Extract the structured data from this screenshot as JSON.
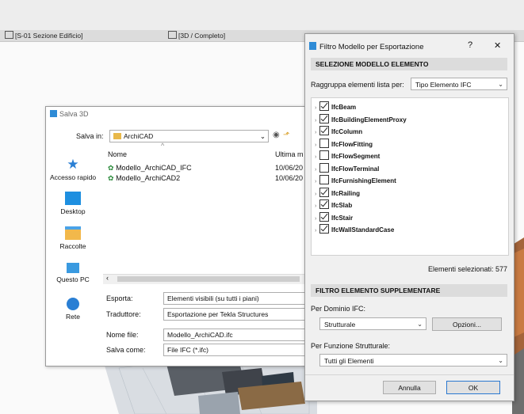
{
  "tabs": [
    {
      "label": "[S-01 Sezione Edificio]"
    },
    {
      "label": "[3D / Completo]"
    }
  ],
  "salva": {
    "title": "Salva 3D",
    "save_in_label": "Salva in:",
    "save_in_value": "ArchiCAD",
    "col_name": "Nome",
    "col_modified": "Ultima m",
    "files": [
      {
        "name": "Modello_ArchiCAD_IFC",
        "date": "10/06/20"
      },
      {
        "name": "Modello_ArchiCAD2",
        "date": "10/06/20"
      }
    ],
    "nav": [
      {
        "label": "Accesso rapido",
        "icon": "star-icon"
      },
      {
        "label": "Desktop",
        "icon": "desktop-icon"
      },
      {
        "label": "Raccolte",
        "icon": "libraries-icon"
      },
      {
        "label": "Questo PC",
        "icon": "computer-icon"
      },
      {
        "label": "Rete",
        "icon": "network-icon"
      }
    ],
    "export_label": "Esporta:",
    "export_value": "Elementi visibili (su tutti i piani)",
    "translator_label": "Traduttore:",
    "translator_value": "Esportazione per Tekla Structures",
    "filename_label": "Nome file:",
    "filename_value": "Modello_ArchiCAD.ifc",
    "saveas_label": "Salva come:",
    "saveas_value": "File IFC (*.ifc)"
  },
  "filtro": {
    "title": "Filtro Modello per Esportazione",
    "help": "?",
    "close": "✕",
    "section1": "SELEZIONE MODELLO ELEMENTO",
    "group_label": "Raggruppa elementi lista per:",
    "group_value": "Tipo Elemento IFC",
    "items": [
      {
        "label": "IfcBeam",
        "checked": true
      },
      {
        "label": "IfcBuildingElementProxy",
        "checked": true
      },
      {
        "label": "IfcColumn",
        "checked": true
      },
      {
        "label": "IfcFlowFitting",
        "checked": false
      },
      {
        "label": "IfcFlowSegment",
        "checked": false
      },
      {
        "label": "IfcFlowTerminal",
        "checked": false
      },
      {
        "label": "IfcFurnishingElement",
        "checked": false
      },
      {
        "label": "IfcRailing",
        "checked": true
      },
      {
        "label": "IfcSlab",
        "checked": true
      },
      {
        "label": "IfcStair",
        "checked": true
      },
      {
        "label": "IfcWallStandardCase",
        "checked": true
      }
    ],
    "selected_count": "Elementi selezionati: 577",
    "section2": "FILTRO ELEMENTO SUPPLEMENTARE",
    "domain_label": "Per Dominio IFC:",
    "domain_value": "Strutturale",
    "options_button": "Opzioni...",
    "function_label": "Per Funzione Strutturale:",
    "function_value": "Tutti gli Elementi",
    "cancel_button": "Annulla",
    "ok_button": "OK"
  }
}
